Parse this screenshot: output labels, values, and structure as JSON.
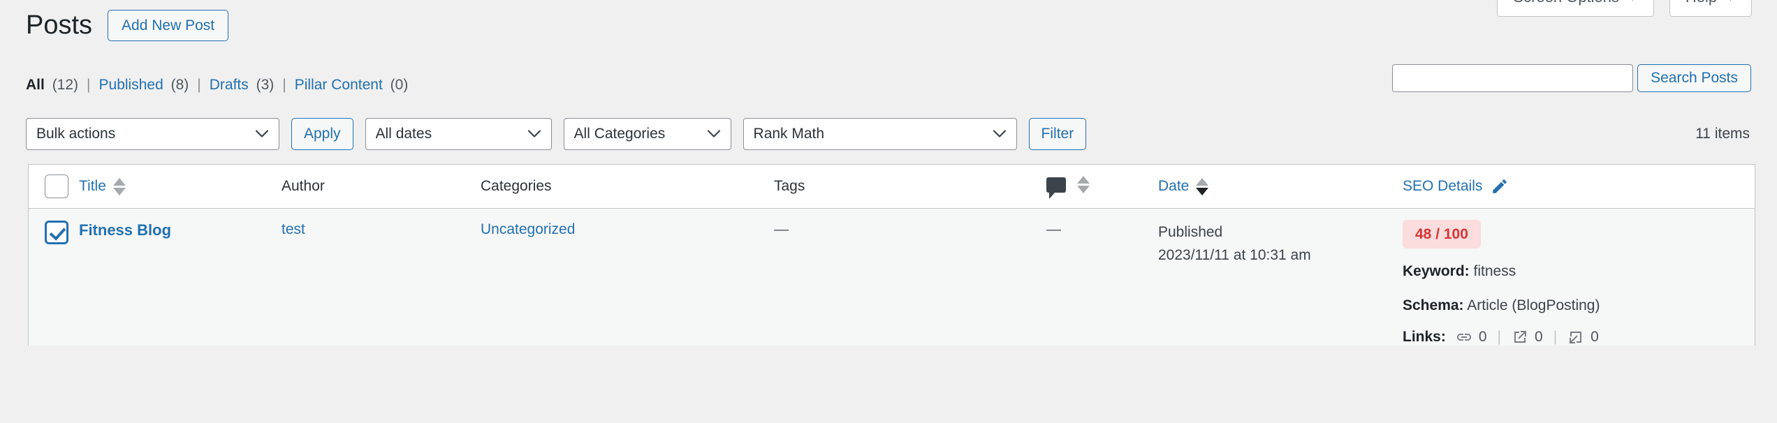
{
  "screen_meta": {
    "screen_options_label": "Screen Options",
    "help_label": "Help",
    "caret": "▼"
  },
  "header": {
    "page_title": "Posts",
    "add_new_label": "Add New Post"
  },
  "status_links": [
    {
      "label": "All",
      "count": "(12)",
      "current": true
    },
    {
      "label": "Published",
      "count": "(8)",
      "current": false
    },
    {
      "label": "Drafts",
      "count": "(3)",
      "current": false
    },
    {
      "label": "Pillar Content",
      "count": "(0)",
      "current": false
    }
  ],
  "separator": "|",
  "search": {
    "value": "",
    "placeholder": "",
    "submit_label": "Search Posts"
  },
  "tablenav": {
    "bulk_actions_value": "Bulk actions",
    "apply_label": "Apply",
    "dates_value": "All dates",
    "categories_value": "All Categories",
    "rank_math_value": "Rank Math",
    "filter_label": "Filter",
    "items_count": "11 items"
  },
  "table": {
    "columns": {
      "title": "Title",
      "author": "Author",
      "categories": "Categories",
      "tags": "Tags",
      "comments_icon": "comment-bubble-icon",
      "date": "Date",
      "seo_details": "SEO Details",
      "seo_edit_icon": "pencil-icon"
    },
    "sort": {
      "title_state": "none",
      "comments_state": "none",
      "date_state": "desc"
    },
    "rows": [
      {
        "selected": true,
        "title": "Fitness Blog",
        "author": "test",
        "categories": "Uncategorized",
        "tags": "—",
        "comments": "—",
        "date_status": "Published",
        "date_value": "2023/11/11 at 10:31 am",
        "seo": {
          "score": "48 / 100",
          "score_color": "#d63638",
          "score_bg": "#fbdddd",
          "keyword_label": "Keyword:",
          "keyword_value": "fitness",
          "schema_label": "Schema:",
          "schema_value": "Article (BlogPosting)",
          "links_label": "Links:",
          "internal_links_icon": "chain-link-icon",
          "internal_links_count": "0",
          "external_links_icon": "external-link-icon",
          "external_links_count": "0",
          "incoming_links_icon": "incoming-link-icon",
          "incoming_links_count": "0",
          "links_separator": "|"
        }
      }
    ]
  }
}
